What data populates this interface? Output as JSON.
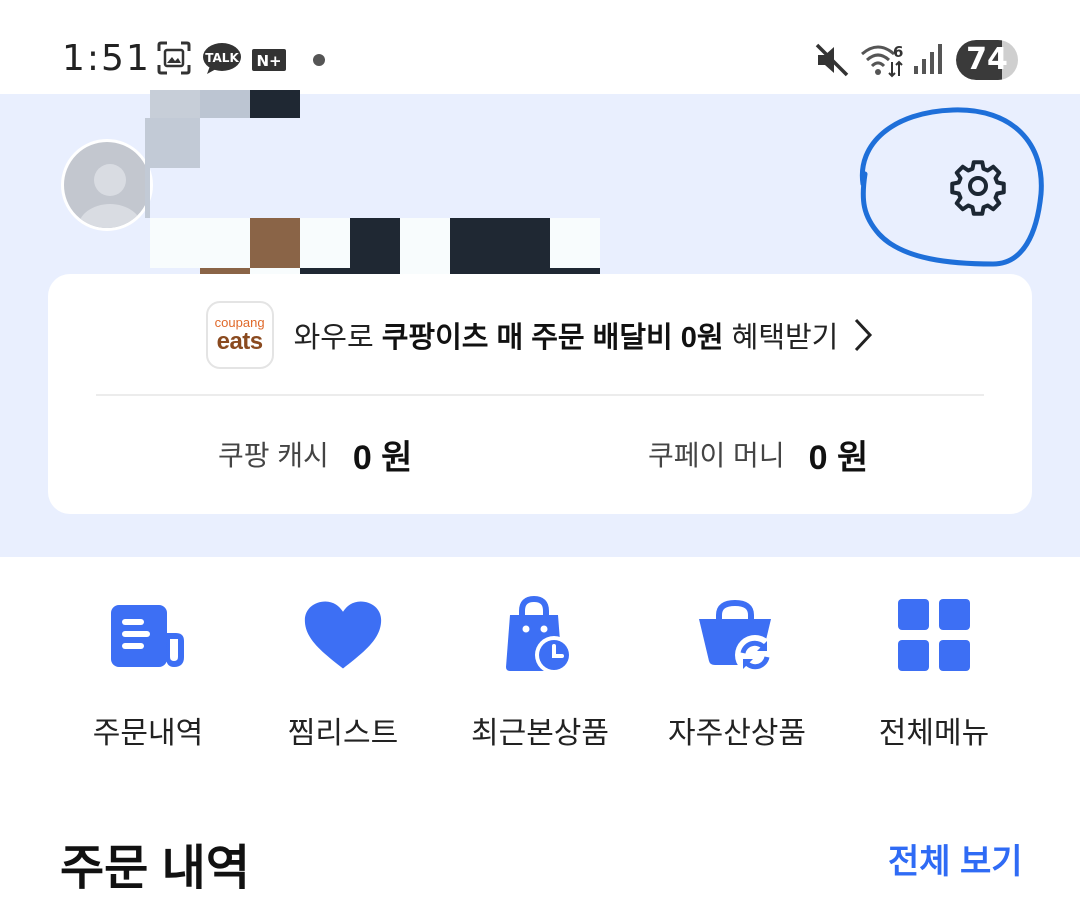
{
  "status_bar": {
    "time": "1:51",
    "notification_icons": [
      "screenshot-icon",
      "kakaotalk-icon",
      "naver-plus-icon",
      "dot-icon"
    ],
    "talk_text": "TALK",
    "naver_text": "N+",
    "system_icons": [
      "mute-icon",
      "wifi-icon",
      "signal-icon"
    ],
    "wifi_label": "6",
    "battery": "74",
    "battery_level": 0.74
  },
  "profile": {
    "avatar_icon": "user-avatar-icon",
    "settings_icon": "gear-icon",
    "annotation_color": "#1e6fd9"
  },
  "promo": {
    "logo_small": "coupang",
    "logo_big": "eats",
    "text_prefix": "와우로 ",
    "text_bold": "쿠팡이츠 매 주문 배달비 0원",
    "text_suffix": " 혜택받기",
    "chevron_icon": "chevron-right-icon"
  },
  "balances": {
    "cash_label": "쿠팡 캐시",
    "cash_value": "0 원",
    "money_label": "쿠페이 머니",
    "money_value": "0 원"
  },
  "quick_menu": [
    {
      "label": "주문내역",
      "icon": "order-history-icon"
    },
    {
      "label": "찜리스트",
      "icon": "heart-icon"
    },
    {
      "label": "최근본상품",
      "icon": "recent-bag-icon"
    },
    {
      "label": "자주산상품",
      "icon": "repurchase-basket-icon"
    },
    {
      "label": "전체메뉴",
      "icon": "grid-menu-icon"
    }
  ],
  "order_section": {
    "title": "주문 내역",
    "view_all": "전체 보기"
  },
  "colors": {
    "accent": "#2f6bf5",
    "icon_blue": "#3d6ff4",
    "header_bg": "#e9effe"
  }
}
